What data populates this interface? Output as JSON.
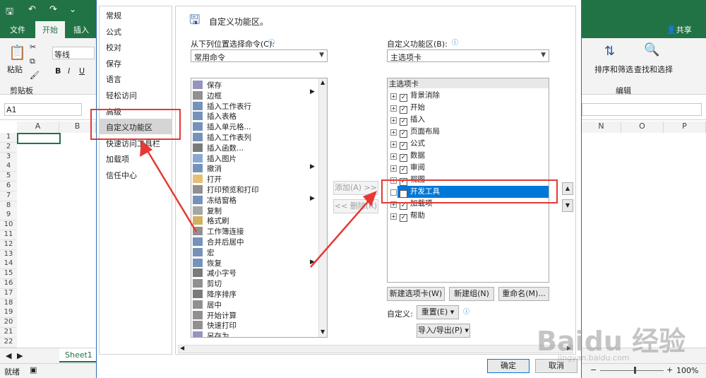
{
  "excel": {
    "tabs": [
      "文件",
      "开始",
      "插入"
    ],
    "active_tab": "开始",
    "share": "共享",
    "font_name": "等线",
    "paste": "粘贴",
    "clipboard": "剪贴板",
    "bold": "B",
    "italic": "I",
    "underline": "U",
    "sort_filter": "排序和筛选",
    "find_select": "查找和选择",
    "edit_group": "编辑",
    "name_box": "A1",
    "col_headers": [
      "A",
      "B",
      "N",
      "O",
      "P"
    ],
    "row_headers": [
      "1",
      "2",
      "3",
      "4",
      "5",
      "6",
      "7",
      "8",
      "9",
      "10",
      "11",
      "12",
      "13",
      "14",
      "15",
      "16",
      "17",
      "18",
      "19",
      "20",
      "21",
      "22"
    ],
    "sheet_tab": "Sheet1",
    "status": "就绪",
    "zoom": "100%"
  },
  "dialog": {
    "categories": [
      "常规",
      "公式",
      "校对",
      "保存",
      "语言",
      "轻松访问",
      "高级",
      "自定义功能区",
      "快速访问工具栏",
      "加载项",
      "信任中心"
    ],
    "selected_category": "自定义功能区",
    "heading": "自定义功能区。",
    "choose_from_label": "从下列位置选择命令(C):",
    "choose_from_value": "常用命令",
    "customize_label": "自定义功能区(B):",
    "customize_value": "主选项卡",
    "commands": [
      "保存",
      "边框",
      "插入工作表行",
      "插入表格",
      "插入单元格...",
      "插入工作表列",
      "插入函数...",
      "插入图片",
      "撤消",
      "打开",
      "打印预览和打印",
      "冻结窗格",
      "复制",
      "格式刷",
      "工作簿连接",
      "合并后居中",
      "宏",
      "恢复",
      "减小字号",
      "剪切",
      "降序排序",
      "居中",
      "开始计算",
      "快速打印",
      "另存为"
    ],
    "tree_header": "主选项卡",
    "tree_items": [
      "背景消除",
      "开始",
      "插入",
      "页面布局",
      "公式",
      "数据",
      "审阅",
      "视图",
      "开发工具",
      "加载项",
      "帮助"
    ],
    "highlighted_item": "开发工具",
    "add_button": "添加(A) >>",
    "remove_button": "<< 删除(R)",
    "new_tab_button": "新建选项卡(W)",
    "new_group_button": "新建组(N)",
    "rename_button": "重命名(M)...",
    "customize_label2": "自定义:",
    "reset_button": "重置(E) ▾",
    "import_export_button": "导入/导出(P) ▾",
    "ok_button": "确定",
    "cancel_button": "取消"
  },
  "watermark": {
    "brand": "Baidu 经验",
    "url": "jingyan.baidu.com"
  },
  "colors": {
    "excel_green": "#217346",
    "highlight": "#0078d7",
    "annotation_red": "#e53935"
  }
}
